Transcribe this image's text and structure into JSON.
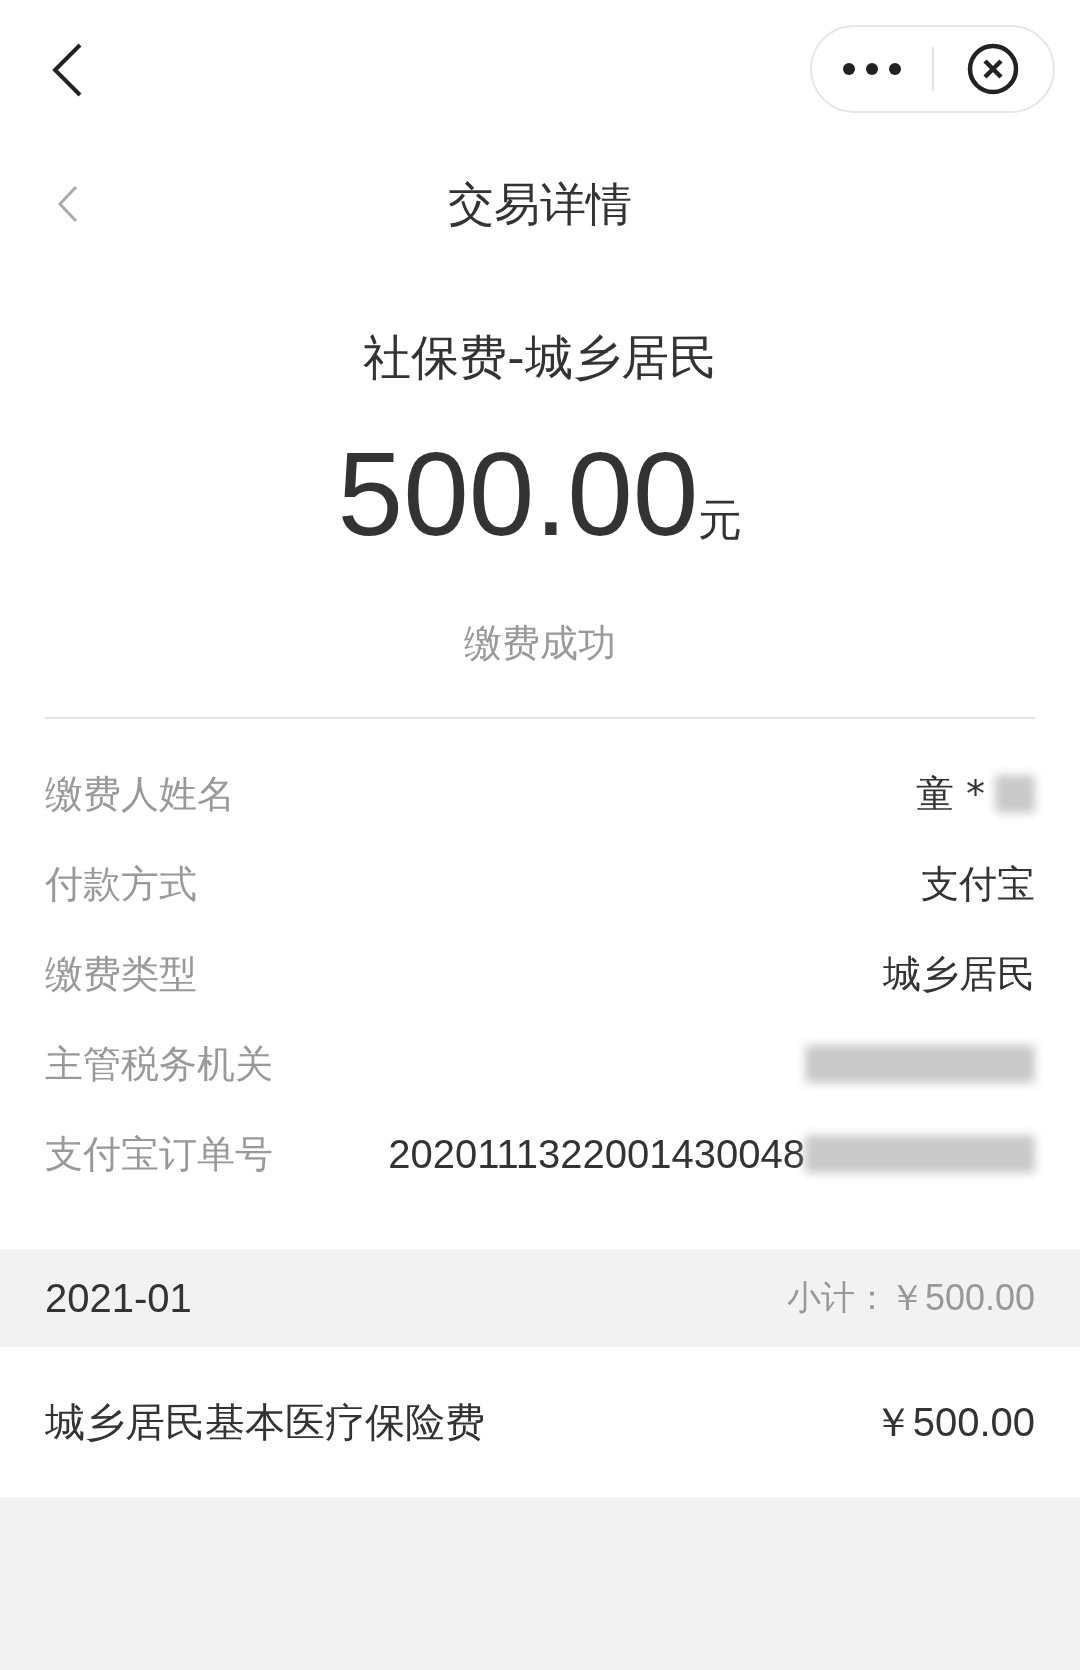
{
  "header": {
    "title": "交易详情"
  },
  "summary": {
    "name": "社保费-城乡居民",
    "amount": "500.00",
    "unit": "元",
    "status": "缴费成功"
  },
  "details": [
    {
      "label": "缴费人姓名",
      "value": "童 *",
      "redacted": true
    },
    {
      "label": "付款方式",
      "value": "支付宝",
      "redacted": false
    },
    {
      "label": "缴费类型",
      "value": "城乡居民",
      "redacted": false
    },
    {
      "label": "主管税务机关",
      "redacted": true
    },
    {
      "label": "支付宝订单号",
      "value": "2020111322001430048",
      "redacted": true
    }
  ],
  "period": {
    "month": "2021-01",
    "subtotal_label": "小计：",
    "subtotal": "￥500.00"
  },
  "items": [
    {
      "name": "城乡居民基本医疗保险费",
      "amount": "￥500.00"
    }
  ]
}
